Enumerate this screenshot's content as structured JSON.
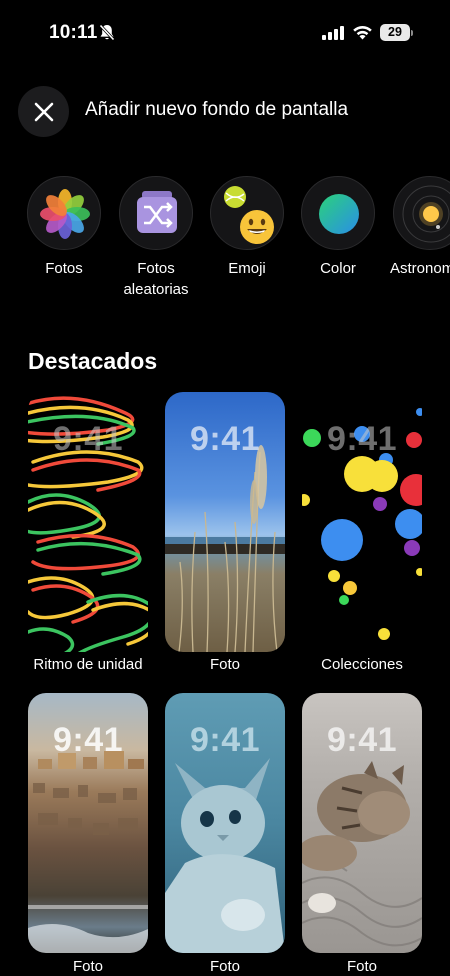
{
  "status_bar": {
    "time": "10:11",
    "battery": "29"
  },
  "header": {
    "title": "Añadir nuevo fondo de pantalla"
  },
  "categories": [
    {
      "label": "Fotos",
      "icon": "photos-icon"
    },
    {
      "label": "Fotos aleatorias",
      "icon": "shuffle-icon"
    },
    {
      "label": "Emoji",
      "icon": "emoji-icon"
    },
    {
      "label": "Color",
      "icon": "color-icon"
    },
    {
      "label": "Astronomía",
      "icon": "astronomy-icon"
    }
  ],
  "featured": {
    "title": "Destacados",
    "cards": [
      {
        "time": "9:41",
        "label": "Ritmo de unidad"
      },
      {
        "time": "9:41",
        "label": "Foto"
      },
      {
        "time": "9:41",
        "label": "Colecciones"
      },
      {
        "time": "9:41",
        "label": "Foto"
      },
      {
        "time": "9:41",
        "label": "Foto"
      },
      {
        "time": "9:41",
        "label": "Foto"
      }
    ]
  },
  "colors": {
    "background": "#000000",
    "accent_blue": "#3d8ef0"
  }
}
